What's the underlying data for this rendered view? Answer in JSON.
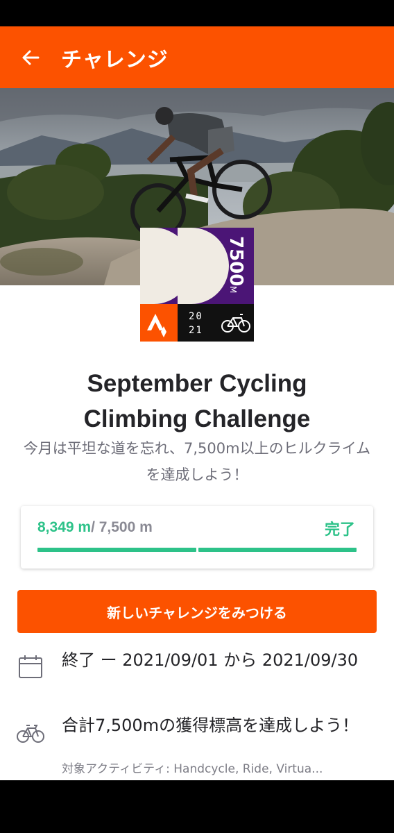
{
  "app_bar": {
    "title": "チャレンジ",
    "back_icon": "arrow-left-icon",
    "color": "#fc5200"
  },
  "badge": {
    "elevation_text": "7500",
    "unit": "M",
    "year_top": "20",
    "year_bottom": "21",
    "colors": {
      "purple": "#4b1576",
      "orange": "#fc5200",
      "cream": "#f0ebe3",
      "black": "#111111"
    }
  },
  "challenge": {
    "title_line1": "September Cycling",
    "title_line2": "Climbing Challenge",
    "description": "今月は平坦な道を忘れ、7,500m以上のヒルクライムを達成しよう！"
  },
  "progress": {
    "current": "8,349 m",
    "goal": "/ 7,500 m",
    "status": "完了",
    "fraction": 1.0,
    "segments": 2,
    "color": "#2dc289"
  },
  "cta": {
    "label": "新しいチャレンジをみつける"
  },
  "info": {
    "dates": {
      "icon": "calendar-icon",
      "text": "終了 ー 2021/09/01 から 2021/09/30"
    },
    "goal": {
      "icon": "bicycle-icon",
      "text": "合計7,500mの獲得標高を達成しよう！",
      "sub": "対象アクティビティ: Handcycle, Ride, Virtua..."
    }
  }
}
